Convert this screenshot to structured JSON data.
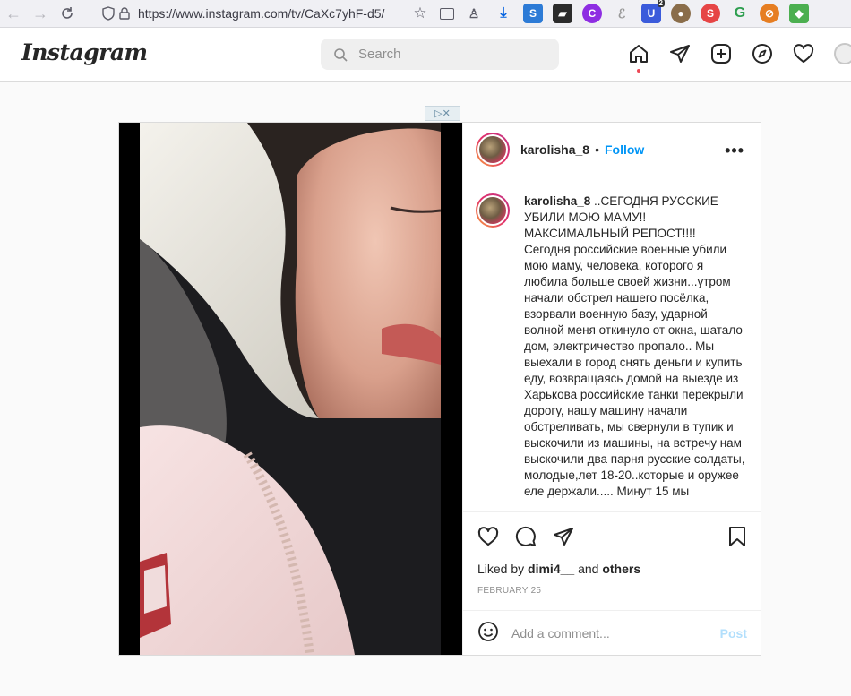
{
  "browser": {
    "url": "https://www.instagram.com/tv/CaXc7yhF-d5/",
    "ext_badge": "2"
  },
  "header": {
    "logo": "Instagram",
    "search_placeholder": "Search"
  },
  "ad": {
    "label": "▷✕"
  },
  "post": {
    "username": "karolisha_8",
    "follow_label": "Follow",
    "more_label": "•••",
    "caption_username": "karolisha_8",
    "caption_text": " ..СЕГОДНЯ РУССКИЕ УБИЛИ МОЮ МАМУ!!\nМАКСИМАЛЬНЫЙ РЕПОСТ!!!!\nСегодня российские военные убили мою маму, человека, которого я любила больше своей жизни...утром начали обстрел нашего посёлка, взорвали военную базу, ударной волной меня откинуло от окна, шатало дом, электричество пропало.. Мы выехали в город снять деньги и купить еду, возвращаясь домой на выезде из Харькова российские танки перекрыли дорогу, нашу машину начали обстреливать, мы свернули в тупик и выскочили из машины, на встречу нам выскочили два парня русские солдаты, молодые,лет 18-20..которые и оружее еле держали..... Минут 15 мы",
    "liked_by_prefix": "Liked by ",
    "liked_by_user": "dimi4__",
    "liked_by_and": " and ",
    "liked_by_others": "others",
    "date": "FEBRUARY 25",
    "comment_placeholder": "Add a comment...",
    "post_button": "Post"
  }
}
